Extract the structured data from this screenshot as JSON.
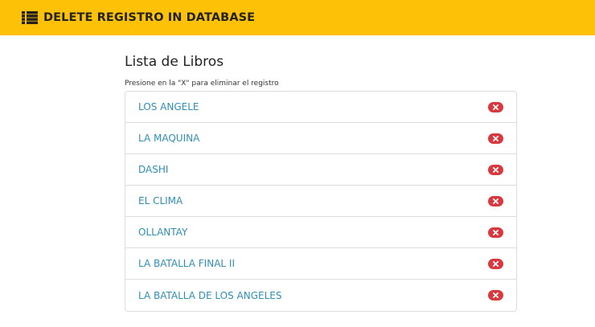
{
  "navbar": {
    "icon": "list-icon",
    "title": "DELETE REGISTRO IN DATABASE",
    "color": "#fdc107"
  },
  "main": {
    "title": "Lista de Libros",
    "subtitle": "Presione en la \"X\" para eliminar el registro",
    "delete_icon": "close-icon",
    "delete_color": "#d9383e",
    "link_color": "#2f8fb3",
    "items": [
      {
        "label": "LOS ANGELE"
      },
      {
        "label": "LA MAQUINA"
      },
      {
        "label": "DASHI"
      },
      {
        "label": "EL CLIMA"
      },
      {
        "label": "OLLANTAY"
      },
      {
        "label": "LA BATALLA FINAL II"
      },
      {
        "label": "LA BATALLA DE LOS ANGELES"
      }
    ]
  }
}
